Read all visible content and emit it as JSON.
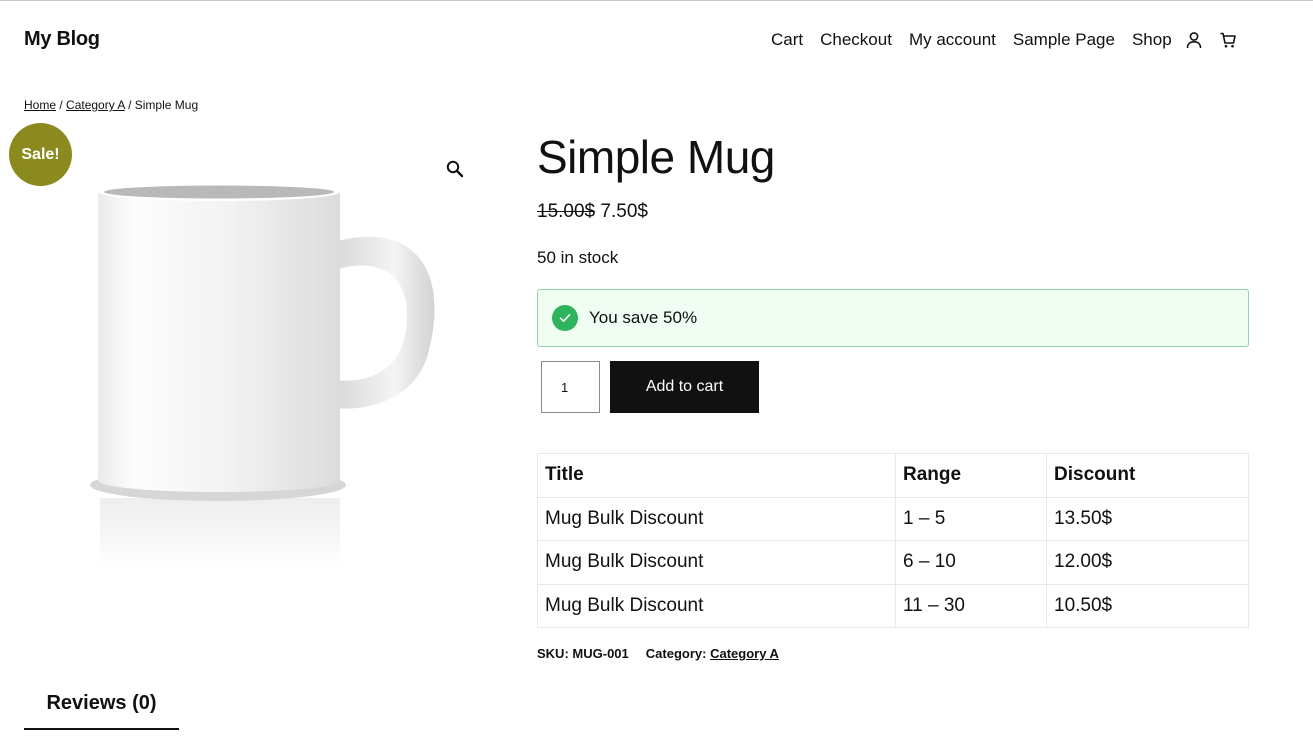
{
  "header": {
    "site_title": "My Blog",
    "nav": [
      {
        "label": "Cart"
      },
      {
        "label": "Checkout"
      },
      {
        "label": "My account"
      },
      {
        "label": "Sample Page"
      },
      {
        "label": "Shop"
      }
    ],
    "account_icon": "user-icon",
    "cart_icon": "cart-icon"
  },
  "breadcrumb": {
    "home": "Home",
    "separator": " / ",
    "category": "Category A",
    "current": "Simple Mug"
  },
  "gallery": {
    "sale_badge": "Sale!",
    "zoom_icon": "magnifier-icon",
    "image": "white-mug"
  },
  "product": {
    "title": "Simple Mug",
    "old_price": "15.00$",
    "price": "7.50$",
    "stock": "50 in stock",
    "save_notice": "You save 50%",
    "quantity": "1",
    "add_to_cart": "Add to cart"
  },
  "discount_table": {
    "headers": [
      "Title",
      "Range",
      "Discount"
    ],
    "rows": [
      [
        "Mug Bulk Discount",
        "1 – 5",
        "13.50$"
      ],
      [
        "Mug Bulk Discount",
        "6 – 10",
        "12.00$"
      ],
      [
        "Mug Bulk Discount",
        "11 – 30",
        "10.50$"
      ]
    ]
  },
  "meta": {
    "sku_label": "SKU:",
    "sku": "MUG-001",
    "category_label": "Category:",
    "category": "Category A"
  },
  "tabs": {
    "reviews": "Reviews (0)"
  },
  "colors": {
    "sale_badge": "#8b8a1f",
    "notice_bg": "#effdf3",
    "notice_border": "#8fd6a7",
    "check": "#2eb45c",
    "button": "#111111"
  }
}
